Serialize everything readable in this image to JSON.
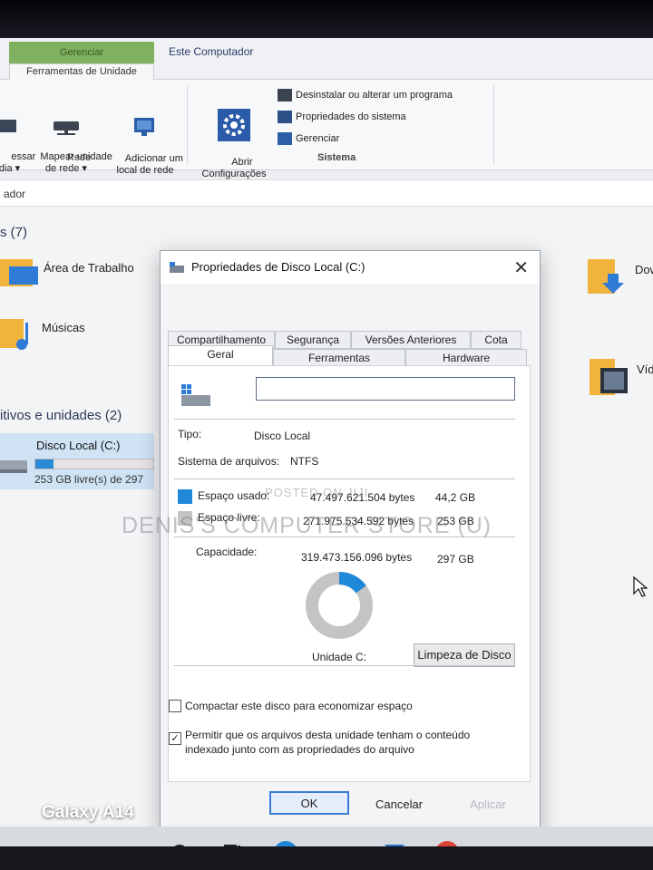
{
  "ribbon": {
    "context_tab": "Gerenciar",
    "sub_tab": "Ferramentas de Unidade",
    "computer_tab": "Este Computador",
    "rede": {
      "acessar_label": "essar\nídia ▾",
      "mapear_label": "Mapear unidade\nde rede ▾",
      "adicionar_label": "Adicionar um\nlocal de rede",
      "group": "Rede"
    },
    "abrir_label": "Abrir\nConfigurações",
    "sistema": {
      "items": [
        "Desinstalar ou alterar um programa",
        "Propriedades do sistema",
        "Gerenciar"
      ],
      "group": "Sistema"
    }
  },
  "address": {
    "text": "ador"
  },
  "content": {
    "folders_header": "s (7)",
    "folders": [
      {
        "name": "Área de Trabalho"
      },
      {
        "name": "Músicas"
      },
      {
        "name": "Dow"
      },
      {
        "name": "Víd"
      }
    ],
    "devices_header": "itivos e unidades (2)",
    "drive": {
      "name": "Disco Local (C:)",
      "free_text": "253 GB livre(s) de 297",
      "used_fraction": 0.15
    }
  },
  "dialog": {
    "title": "Propriedades de Disco Local (C:)",
    "tabs_row1": [
      "Compartilhamento",
      "Segurança",
      "Versões Anteriores",
      "Cota"
    ],
    "tabs_row2": [
      "Geral",
      "Ferramentas",
      "Hardware"
    ],
    "active_tab": "Geral",
    "name_value": "",
    "tipo_label": "Tipo:",
    "tipo_value": "Disco Local",
    "fs_label": "Sistema de arquivos:",
    "fs_value": "NTFS",
    "used_label": "Espaço usado:",
    "used_bytes": "47.497.621.504 bytes",
    "used_gb": "44,2 GB",
    "free_label": "Espaço livre:",
    "free_bytes": "271.975.534.592 bytes",
    "free_gb": "253 GB",
    "cap_label": "Capacidade:",
    "cap_bytes": "319.473.156.096 bytes",
    "cap_gb": "297 GB",
    "unit_label": "Unidade C:",
    "cleanup_label": "Limpeza de Disco",
    "compress_label": "Compactar este disco para economizar espaço",
    "compress_checked": false,
    "index_label_1": "Permitir que os arquivos desta unidade tenham o conteúdo",
    "index_label_2": "indexado junto com as propriedades do arquivo",
    "index_checked": true,
    "ok_label": "OK",
    "cancel_label": "Cancelar",
    "apply_label": "Aplicar",
    "used_fraction": 0.149,
    "colors": {
      "used": "#1f88d9",
      "free": "#c4c4c4"
    }
  },
  "watermark": {
    "line1": "POSTED ON JIJI",
    "line2": "DENIS'S COMPUTER STORE (U)"
  },
  "phone_label": "Galaxy A14"
}
